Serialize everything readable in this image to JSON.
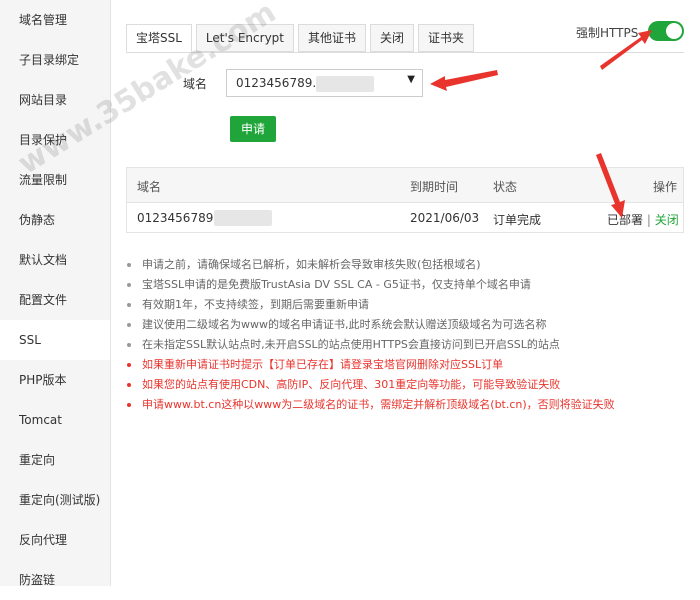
{
  "sidebar": {
    "items": [
      {
        "label": "域名管理"
      },
      {
        "label": "子目录绑定"
      },
      {
        "label": "网站目录"
      },
      {
        "label": "目录保护"
      },
      {
        "label": "流量限制"
      },
      {
        "label": "伪静态"
      },
      {
        "label": "默认文档"
      },
      {
        "label": "配置文件"
      },
      {
        "label": "SSL"
      },
      {
        "label": "PHP版本"
      },
      {
        "label": "Tomcat"
      },
      {
        "label": "重定向"
      },
      {
        "label": "重定向(测试版)"
      },
      {
        "label": "反向代理"
      },
      {
        "label": "防盗链"
      }
    ],
    "active_index": 8
  },
  "tabs": [
    {
      "label": "宝塔SSL"
    },
    {
      "label": "Let's Encrypt"
    },
    {
      "label": "其他证书"
    },
    {
      "label": "关闭"
    },
    {
      "label": "证书夹"
    }
  ],
  "force_https": {
    "label": "强制HTTPS",
    "enabled": true
  },
  "domain": {
    "label": "域名",
    "value": "0123456789."
  },
  "apply_button": "申请",
  "table": {
    "headers": {
      "domain": "域名",
      "expire": "到期时间",
      "status": "状态",
      "actions": "操作"
    },
    "rows": [
      {
        "domain": "0123456789.",
        "expire": "2021/06/03",
        "status": "订单完成",
        "deployed": "已部署",
        "separator": "|",
        "close": "关闭"
      }
    ]
  },
  "tips": [
    {
      "text": "申请之前，请确保域名已解析，如未解析会导致审核失败(包括根域名)",
      "red": false
    },
    {
      "text": "宝塔SSL申请的是免费版TrustAsia DV SSL CA - G5证书，仅支持单个域名申请",
      "red": false
    },
    {
      "text": "有效期1年，不支持续签，到期后需要重新申请",
      "red": false
    },
    {
      "text": "建议使用二级域名为www的域名申请证书,此时系统会默认赠送顶级域名为可选名称",
      "red": false
    },
    {
      "text": "在未指定SSL默认站点时,未开启SSL的站点使用HTTPS会直接访问到已开启SSL的站点",
      "red": false
    },
    {
      "text": "如果重新申请证书时提示【订单已存在】请登录宝塔官网删除对应SSL订单",
      "red": true
    },
    {
      "text": "如果您的站点有使用CDN、高防IP、反向代理、301重定向等功能，可能导致验证失败",
      "red": true
    },
    {
      "text": "申请www.bt.cn这种以www为二级域名的证书，需绑定并解析顶级域名(bt.cn)，否则将验证失败",
      "red": true
    }
  ],
  "watermark": "www.35bake.com",
  "colors": {
    "accent": "#20a53a",
    "warning": "#e8342d",
    "annotation": "#e8342d"
  }
}
